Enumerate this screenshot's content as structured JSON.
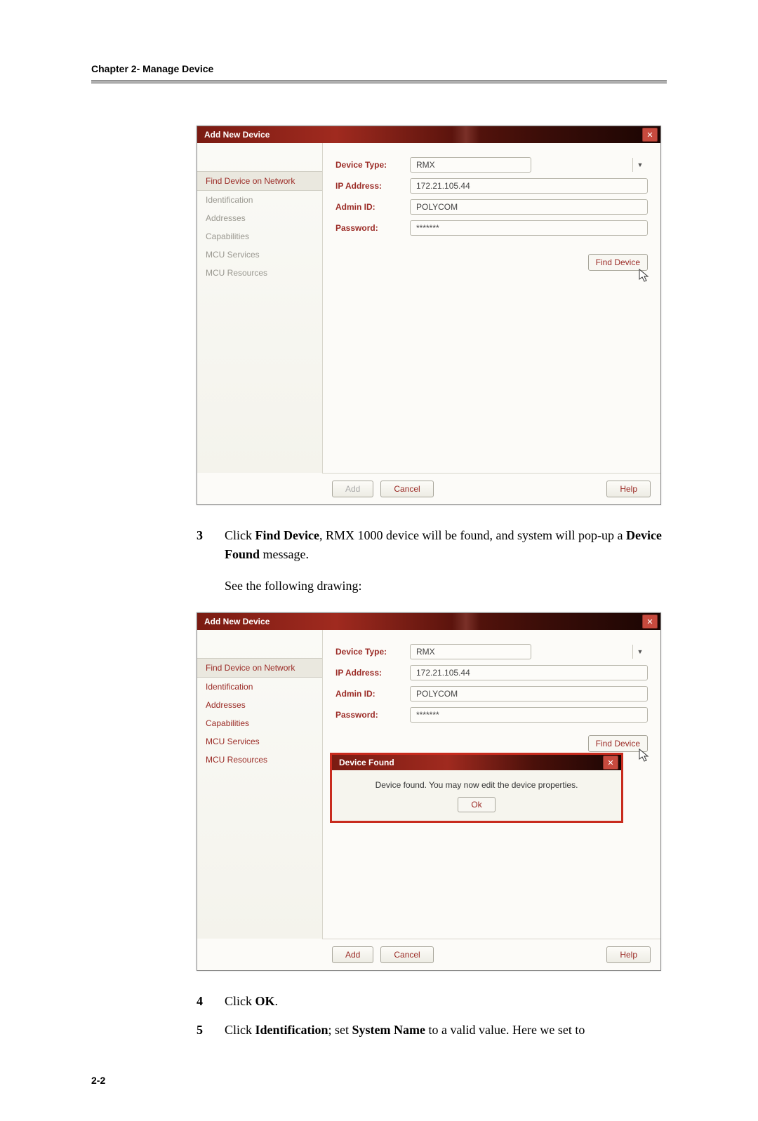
{
  "header": {
    "chapter": "Chapter 2- Manage Device"
  },
  "dialog1": {
    "title": "Add New Device",
    "nav": [
      "Find Device on Network",
      "Identification",
      "Addresses",
      "Capabilities",
      "MCU Services",
      "MCU Resources"
    ],
    "labels": {
      "device_type": "Device Type:",
      "ip_address": "IP Address:",
      "admin_id": "Admin ID:",
      "password": "Password:"
    },
    "values": {
      "device_type": "RMX",
      "ip_address": "172.21.105.44",
      "admin_id": "POLYCOM",
      "password": "*******"
    },
    "buttons": {
      "find": "Find Device",
      "add": "Add",
      "cancel": "Cancel",
      "help": "Help"
    }
  },
  "step3": {
    "num": "3",
    "pre": "Click ",
    "bold1": "Find Device",
    "mid": ", RMX 1000 device will be found, and system will pop-up a ",
    "bold2": "Device Found",
    "post": " message."
  },
  "para1": "See the following drawing:",
  "dialog2": {
    "title": "Add New Device",
    "nav": [
      "Find Device on Network",
      "Identification",
      "Addresses",
      "Capabilities",
      "MCU Services",
      "MCU Resources"
    ],
    "labels": {
      "device_type": "Device Type:",
      "ip_address": "IP Address:",
      "admin_id": "Admin ID:",
      "password": "Password:"
    },
    "values": {
      "device_type": "RMX",
      "ip_address": "172.21.105.44",
      "admin_id": "POLYCOM",
      "password": "*******"
    },
    "buttons": {
      "find": "Find Device",
      "add": "Add",
      "cancel": "Cancel",
      "help": "Help"
    },
    "popup": {
      "title": "Device Found",
      "message": "Device found.  You may now edit the device properties.",
      "ok": "Ok"
    }
  },
  "step4": {
    "num": "4",
    "pre": "Click ",
    "bold1": "OK",
    "post": "."
  },
  "step5": {
    "num": "5",
    "pre": "Click ",
    "bold1": "Identification",
    "mid": "; set ",
    "bold2": "System Name",
    "post": " to a valid value. Here we set to"
  },
  "page_num": "2-2"
}
